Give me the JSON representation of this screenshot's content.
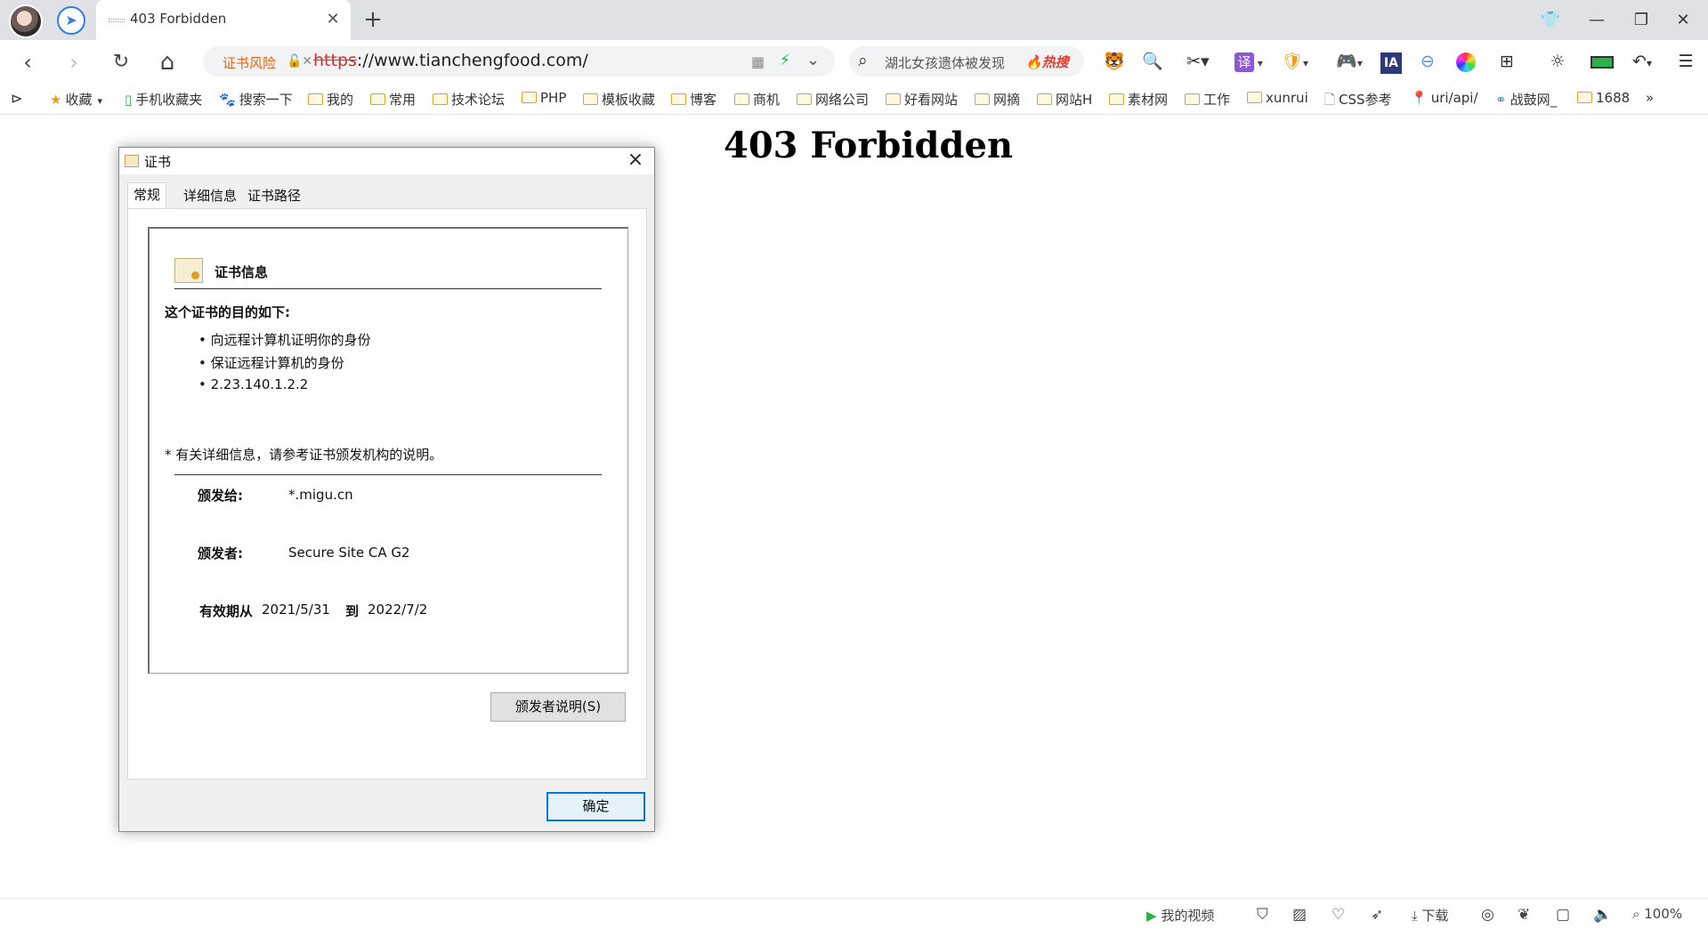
{
  "tabbar": {
    "tab_title": "403 Forbidden",
    "close_glyph": "✕",
    "new_tab_glyph": "+",
    "window_controls": {
      "shirt": "👕",
      "minimize": "—",
      "restore": "❐",
      "close": "✕"
    }
  },
  "toolbar": {
    "back": "‹",
    "forward": "›",
    "reload": "↻",
    "home": "⌂",
    "cert_risk_label": "证书风险",
    "url_protocol": "https",
    "url_rest": "://www.tianchengfood.com/",
    "search_placeholder": "湖北女孩遗体被发现",
    "search_hot": "🔥热搜",
    "icons": [
      "tiger-icon",
      "magnifier-icon",
      "scissors-icon",
      "translate-icon",
      "shield-coin-icon",
      "gamepad-icon",
      "ia-icon",
      "minus-circle-icon",
      "color-wheel-icon",
      "grid-icon",
      "sun-icon",
      "battery-icon",
      "undo-icon",
      "menu-icon"
    ],
    "translate_label": "译",
    "ia_label": "IA"
  },
  "bookmarks": {
    "items": [
      {
        "label": "收藏",
        "type": "star"
      },
      {
        "label": "手机收藏夹",
        "type": "phone"
      },
      {
        "label": "搜索一下",
        "type": "paw"
      },
      {
        "label": "我的",
        "type": "folder"
      },
      {
        "label": "常用",
        "type": "folder"
      },
      {
        "label": "技术论坛",
        "type": "folder"
      },
      {
        "label": "PHP",
        "type": "folder"
      },
      {
        "label": "模板收藏",
        "type": "folder"
      },
      {
        "label": "博客",
        "type": "folder"
      },
      {
        "label": "商机",
        "type": "folder"
      },
      {
        "label": "网络公司",
        "type": "folder"
      },
      {
        "label": "好看网站",
        "type": "folder"
      },
      {
        "label": "网摘",
        "type": "folder"
      },
      {
        "label": "网站H",
        "type": "folder"
      },
      {
        "label": "素材网",
        "type": "folder"
      },
      {
        "label": "工作",
        "type": "folder"
      },
      {
        "label": "xunrui",
        "type": "folder"
      },
      {
        "label": "CSS参考",
        "type": "page"
      },
      {
        "label": "uri/api/",
        "type": "pin"
      },
      {
        "label": "战鼓网_",
        "type": "link"
      },
      {
        "label": "1688",
        "type": "folder"
      }
    ],
    "more": "»"
  },
  "page": {
    "heading": "403 Forbidden"
  },
  "dialog": {
    "title": "证书",
    "tabs": {
      "general": "常规",
      "details": "详细信息",
      "path": "证书路径"
    },
    "info_title": "证书信息",
    "purpose_heading": "这个证书的目的如下:",
    "purposes": [
      "• 向远程计算机证明你的身份",
      "• 保证远程计算机的身份",
      "• 2.23.140.1.2.2"
    ],
    "note": "* 有关详细信息，请参考证书颁发机构的说明。",
    "issued_to_label": "颁发给:",
    "issued_to": "*.migu.cn",
    "issued_by_label": "颁发者:",
    "issued_by": "Secure Site CA G2",
    "valid_from_label": "有效期从",
    "valid_from": "2021/5/31",
    "to_label": "到",
    "valid_to": "2022/7/2",
    "issuer_statement_button": "颁发者说明(S)",
    "ok_button": "确定"
  },
  "statusbar": {
    "my_video": "我的视频",
    "download": "下载",
    "zoom": "100%"
  }
}
